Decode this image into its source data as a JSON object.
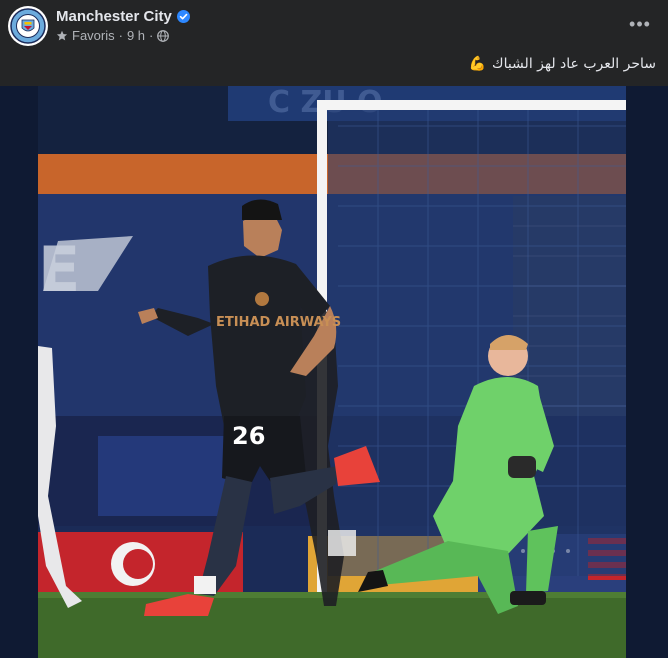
{
  "post": {
    "page_name": "Manchester City",
    "verified": true,
    "audience_label": "Favoris",
    "time": "9 h",
    "audience_icon": "globe-icon",
    "favorite_icon": "star-icon",
    "more_label": "•••",
    "caption": "ساحر العرب عاد لهز الشباك",
    "caption_emoji": "💪",
    "colors": {
      "background": "#242526",
      "text_primary": "#e4e6eb",
      "text_secondary": "#b0b3b8",
      "verified_blue": "#2d88ff"
    }
  },
  "photo": {
    "player_number": "26",
    "shirt_sponsor": "ETIHAD AIRWAYS",
    "pitch_color": "#3f6a2a",
    "goalkeeper_kit": "#6fd16a"
  }
}
